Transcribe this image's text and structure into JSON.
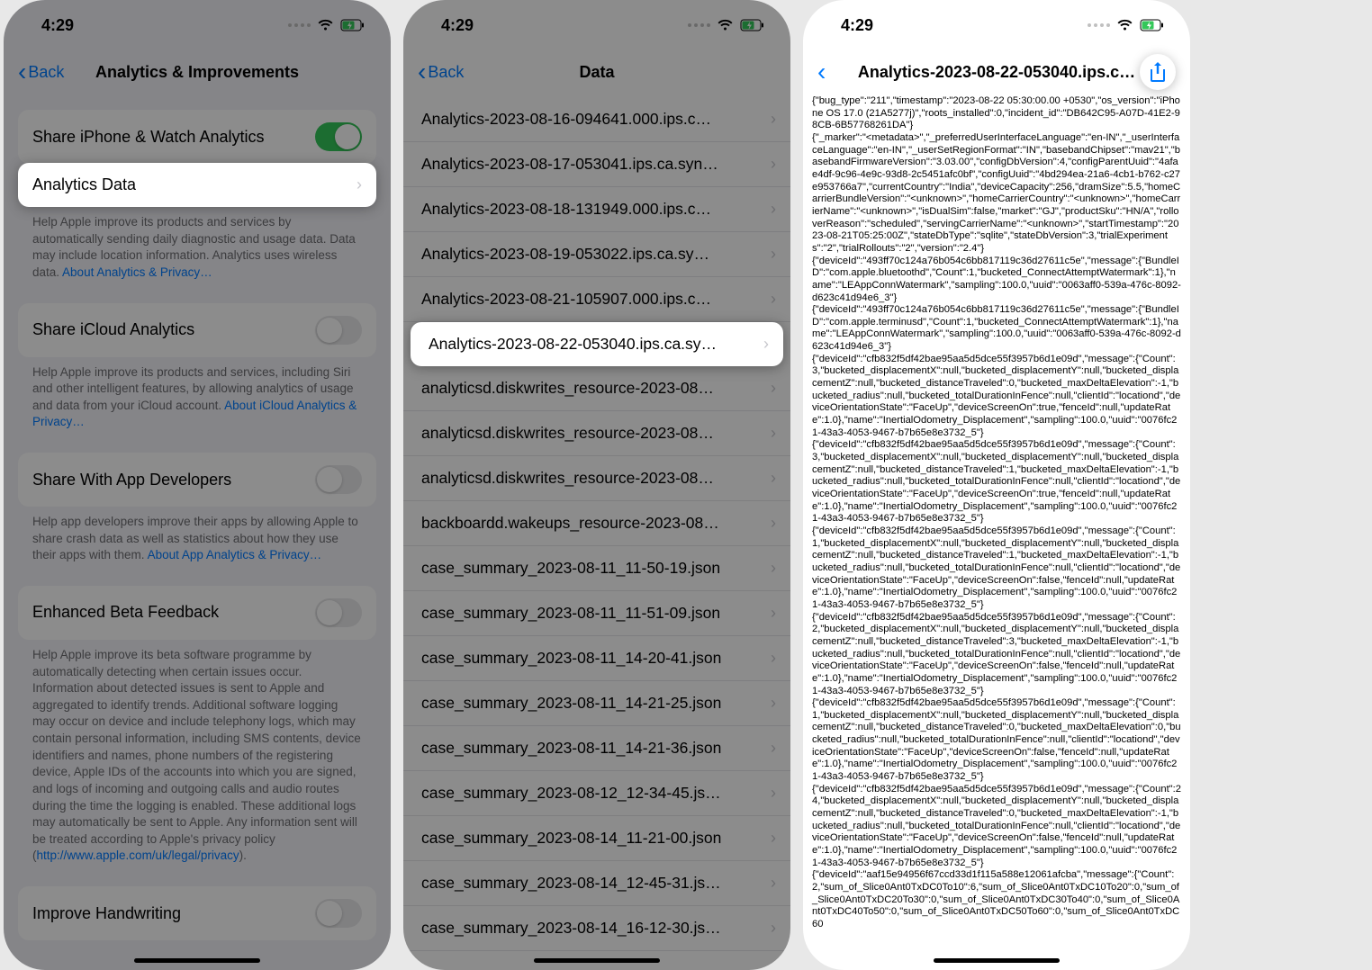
{
  "status": {
    "time": "4:29"
  },
  "screen1": {
    "back": "Back",
    "title": "Analytics & Improvements",
    "rows": {
      "share_analytics": "Share iPhone & Watch Analytics",
      "analytics_data": "Analytics Data",
      "share_icloud": "Share iCloud Analytics",
      "share_dev": "Share With App Developers",
      "beta": "Enhanced Beta Feedback",
      "handwriting": "Improve Handwriting"
    },
    "footers": {
      "f1a": "Help Apple improve its products and services by automatically sending daily diagnostic and usage data. Data may include location information. Analytics uses wireless data.",
      "f1b": "About Analytics & Privacy…",
      "f2a": "Help Apple improve its products and services, including Siri and other intelligent features, by allowing analytics of usage and data from your iCloud account.",
      "f2b": "About iCloud Analytics & Privacy…",
      "f3a": "Help app developers improve their apps by allowing Apple to share crash data as well as statistics about how they use their apps with them.",
      "f3b": "About App Analytics & Privacy…",
      "f4a": "Help Apple improve its beta software programme by automatically detecting when certain issues occur. Information about detected issues is sent to Apple and aggregated to identify trends. Additional software logging may occur on device and include telephony logs, which may contain personal information, including SMS contents, device identifiers and names, phone numbers of the registering device, Apple IDs of the accounts into which you are signed, and logs of incoming and outgoing calls and audio routes during the time the logging is enabled. These additional logs may automatically be sent to Apple. Any information sent will be treated according to Apple's privacy policy (",
      "f4b": "http://www.apple.com/uk/legal/privacy",
      "f4c": ")."
    }
  },
  "screen2": {
    "back": "Back",
    "title": "Data",
    "items": [
      "Analytics-2023-08-16-094641.000.ips.c…",
      "Analytics-2023-08-17-053041.ips.ca.syn…",
      "Analytics-2023-08-18-131949.000.ips.c…",
      "Analytics-2023-08-19-053022.ips.ca.sy…",
      "Analytics-2023-08-21-105907.000.ips.c…",
      "Analytics-2023-08-22-053040.ips.ca.sy…",
      "analyticsd.diskwrites_resource-2023-08…",
      "analyticsd.diskwrites_resource-2023-08…",
      "analyticsd.diskwrites_resource-2023-08…",
      "backboardd.wakeups_resource-2023-08…",
      "case_summary_2023-08-11_11-50-19.json",
      "case_summary_2023-08-11_11-51-09.json",
      "case_summary_2023-08-11_14-20-41.json",
      "case_summary_2023-08-11_14-21-25.json",
      "case_summary_2023-08-11_14-21-36.json",
      "case_summary_2023-08-12_12-34-45.js…",
      "case_summary_2023-08-14_11-21-00.json",
      "case_summary_2023-08-14_12-45-31.js…",
      "case_summary_2023-08-14_16-12-30.js…"
    ],
    "highlight_index": 5
  },
  "screen3": {
    "title": "Analytics-2023-08-22-053040.ips.c…",
    "log": "{\"bug_type\":\"211\",\"timestamp\":\"2023-08-22 05:30:00.00 +0530\",\"os_version\":\"iPhone OS 17.0 (21A5277j)\",\"roots_installed\":0,\"incident_id\":\"DB642C95-A07D-41E2-98CB-6B57768261DA\"}\n{\"_marker\":\"<metadata>\",\"_preferredUserInterfaceLanguage\":\"en-IN\",\"_userInterfaceLanguage\":\"en-IN\",\"_userSetRegionFormat\":\"IN\",\"basebandChipset\":\"mav21\",\"basebandFirmwareVersion\":\"3.03.00\",\"configDbVersion\":4,\"configParentUuid\":\"4afae4df-9c96-4e9c-93d8-2c5451afc0bf\",\"configUuid\":\"4bd294ea-21a6-4cb1-b762-c27e953766a7\",\"currentCountry\":\"India\",\"deviceCapacity\":256,\"dramSize\":5.5,\"homeCarrierBundleVersion\":\"<unknown>\",\"homeCarrierCountry\":\"<unknown>\",\"homeCarrierName\":\"<unknown>\",\"isDualSim\":false,\"market\":\"GJ\",\"productSku\":\"HN/A\",\"rolloverReason\":\"scheduled\",\"servingCarrierName\":\"<unknown>\",\"startTimestamp\":\"2023-08-21T05:25:00Z\",\"stateDbType\":\"sqlite\",\"stateDbVersion\":3,\"trialExperiments\":\"2\",\"trialRollouts\":\"2\",\"version\":\"2.4\"}\n{\"deviceId\":\"493ff70c124a76b054c6bb817119c36d27611c5e\",\"message\":{\"BundleID\":\"com.apple.bluetoothd\",\"Count\":1,\"bucketed_ConnectAttemptWatermark\":1},\"name\":\"LEAppConnWatermark\",\"sampling\":100.0,\"uuid\":\"0063aff0-539a-476c-8092-d623c41d94e6_3\"}\n{\"deviceId\":\"493ff70c124a76b054c6bb817119c36d27611c5e\",\"message\":{\"BundleID\":\"com.apple.terminusd\",\"Count\":1,\"bucketed_ConnectAttemptWatermark\":1},\"name\":\"LEAppConnWatermark\",\"sampling\":100.0,\"uuid\":\"0063aff0-539a-476c-8092-d623c41d94e6_3\"}\n{\"deviceId\":\"cfb832f5df42bae95aa5d5dce55f3957b6d1e09d\",\"message\":{\"Count\":3,\"bucketed_displacementX\":null,\"bucketed_displacementY\":null,\"bucketed_displacementZ\":null,\"bucketed_distanceTraveled\":0,\"bucketed_maxDeltaElevation\":-1,\"bucketed_radius\":null,\"bucketed_totalDurationInFence\":null,\"clientId\":\"locationd\",\"deviceOrientationState\":\"FaceUp\",\"deviceScreenOn\":true,\"fenceId\":null,\"updateRate\":1.0},\"name\":\"InertialOdometry_Displacement\",\"sampling\":100.0,\"uuid\":\"0076fc21-43a3-4053-9467-b7b65e8e3732_5\"}\n{\"deviceId\":\"cfb832f5df42bae95aa5d5dce55f3957b6d1e09d\",\"message\":{\"Count\":3,\"bucketed_displacementX\":null,\"bucketed_displacementY\":null,\"bucketed_displacementZ\":null,\"bucketed_distanceTraveled\":1,\"bucketed_maxDeltaElevation\":-1,\"bucketed_radius\":null,\"bucketed_totalDurationInFence\":null,\"clientId\":\"locationd\",\"deviceOrientationState\":\"FaceUp\",\"deviceScreenOn\":true,\"fenceId\":null,\"updateRate\":1.0},\"name\":\"InertialOdometry_Displacement\",\"sampling\":100.0,\"uuid\":\"0076fc21-43a3-4053-9467-b7b65e8e3732_5\"}\n{\"deviceId\":\"cfb832f5df42bae95aa5d5dce55f3957b6d1e09d\",\"message\":{\"Count\":1,\"bucketed_displacementX\":null,\"bucketed_displacementY\":null,\"bucketed_displacementZ\":null,\"bucketed_distanceTraveled\":1,\"bucketed_maxDeltaElevation\":-1,\"bucketed_radius\":null,\"bucketed_totalDurationInFence\":null,\"clientId\":\"locationd\",\"deviceOrientationState\":\"FaceUp\",\"deviceScreenOn\":false,\"fenceId\":null,\"updateRate\":1.0},\"name\":\"InertialOdometry_Displacement\",\"sampling\":100.0,\"uuid\":\"0076fc21-43a3-4053-9467-b7b65e8e3732_5\"}\n{\"deviceId\":\"cfb832f5df42bae95aa5d5dce55f3957b6d1e09d\",\"message\":{\"Count\":2,\"bucketed_displacementX\":null,\"bucketed_displacementY\":null,\"bucketed_displacementZ\":null,\"bucketed_distanceTraveled\":3,\"bucketed_maxDeltaElevation\":-1,\"bucketed_radius\":null,\"bucketed_totalDurationInFence\":null,\"clientId\":\"locationd\",\"deviceOrientationState\":\"FaceUp\",\"deviceScreenOn\":false,\"fenceId\":null,\"updateRate\":1.0},\"name\":\"InertialOdometry_Displacement\",\"sampling\":100.0,\"uuid\":\"0076fc21-43a3-4053-9467-b7b65e8e3732_5\"}\n{\"deviceId\":\"cfb832f5df42bae95aa5d5dce55f3957b6d1e09d\",\"message\":{\"Count\":1,\"bucketed_displacementX\":null,\"bucketed_displacementY\":null,\"bucketed_displacementZ\":null,\"bucketed_distanceTraveled\":0,\"bucketed_maxDeltaElevation\":0,\"bucketed_radius\":null,\"bucketed_totalDurationInFence\":null,\"clientId\":\"locationd\",\"deviceOrientationState\":\"FaceUp\",\"deviceScreenOn\":false,\"fenceId\":null,\"updateRate\":1.0},\"name\":\"InertialOdometry_Displacement\",\"sampling\":100.0,\"uuid\":\"0076fc21-43a3-4053-9467-b7b65e8e3732_5\"}\n{\"deviceId\":\"cfb832f5df42bae95aa5d5dce55f3957b6d1e09d\",\"message\":{\"Count\":24,\"bucketed_displacementX\":null,\"bucketed_displacementY\":null,\"bucketed_displacementZ\":null,\"bucketed_distanceTraveled\":0,\"bucketed_maxDeltaElevation\":-1,\"bucketed_radius\":null,\"bucketed_totalDurationInFence\":null,\"clientId\":\"locationd\",\"deviceOrientationState\":\"FaceUp\",\"deviceScreenOn\":false,\"fenceId\":null,\"updateRate\":1.0},\"name\":\"InertialOdometry_Displacement\",\"sampling\":100.0,\"uuid\":\"0076fc21-43a3-4053-9467-b7b65e8e3732_5\"}\n{\"deviceId\":\"aaf15e94956f67ccd33d1f115a588e12061afcba\",\"message\":{\"Count\":2,\"sum_of_Slice0Ant0TxDC0To10\":6,\"sum_of_Slice0Ant0TxDC10To20\":0,\"sum_of_Slice0Ant0TxDC20To30\":0,\"sum_of_Slice0Ant0TxDC30To40\":0,\"sum_of_Slice0Ant0TxDC40To50\":0,\"sum_of_Slice0Ant0TxDC50To60\":0,\"sum_of_Slice0Ant0TxDC60"
  }
}
